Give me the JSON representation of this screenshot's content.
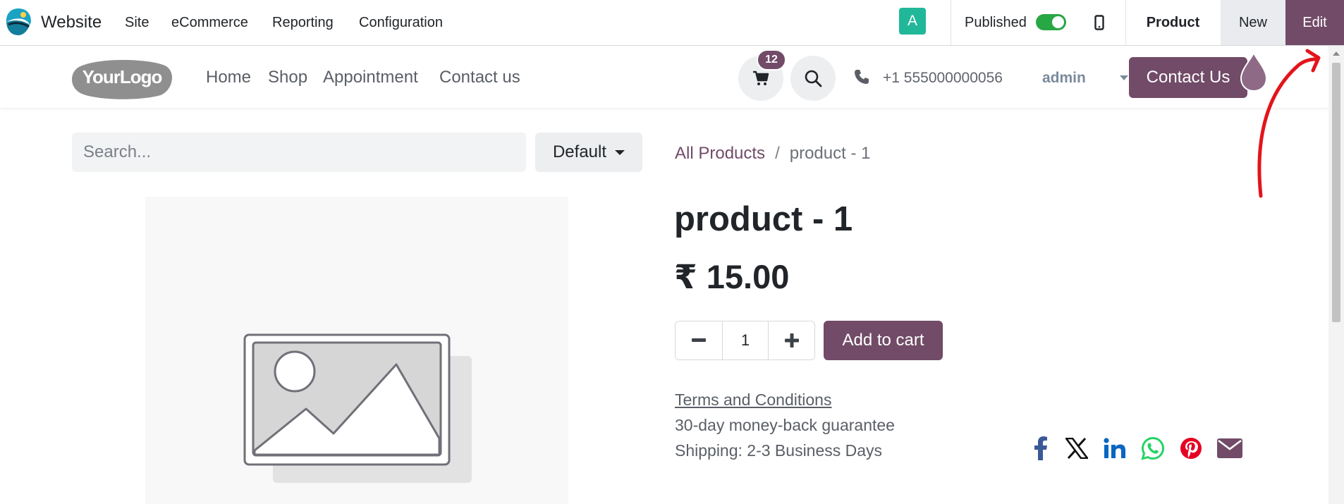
{
  "topbar": {
    "app_name": "Website",
    "menu": [
      "Site",
      "eCommerce",
      "Reporting",
      "Configuration"
    ],
    "avatar_letter": "A",
    "published_label": "Published",
    "published_on": true,
    "product_label": "Product",
    "new_label": "New",
    "edit_label": "Edit"
  },
  "header": {
    "logo_text": "YourLogo",
    "nav": [
      "Home",
      "Shop",
      "Appointment",
      "Contact us"
    ],
    "cart_count": "12",
    "phone": "+1 555000000056",
    "user": "admin",
    "contact_button": "Contact Us"
  },
  "shop": {
    "search_placeholder": "Search...",
    "sort_label": "Default"
  },
  "breadcrumb": {
    "all": "All Products",
    "separator": "/",
    "current": "product - 1"
  },
  "product": {
    "title": "product - 1",
    "price": "₹ 15.00",
    "quantity": "1",
    "add_to_cart": "Add to cart",
    "terms": "Terms and Conditions",
    "guarantee": "30-day money-back guarantee",
    "shipping": "Shipping: 2-3 Business Days"
  },
  "share_icons": [
    "facebook-icon",
    "x-icon",
    "linkedin-icon",
    "whatsapp-icon",
    "pinterest-icon",
    "email-icon"
  ],
  "colors": {
    "brand": "#714b67",
    "toggle_on": "#28a745",
    "avatar": "#21b799",
    "annotation": "#e3141b"
  }
}
